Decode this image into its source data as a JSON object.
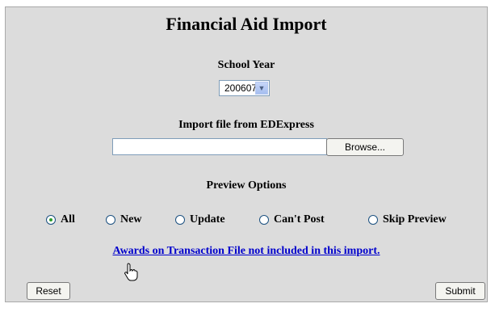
{
  "title": "Financial Aid Import",
  "school_year": {
    "label": "School Year",
    "selected": "200607"
  },
  "import_file": {
    "label": "Import file from EDExpress",
    "value": "",
    "browse_label": "Browse..."
  },
  "preview": {
    "label": "Preview Options",
    "options": [
      "All",
      "New",
      "Update",
      "Can't Post",
      "Skip Preview"
    ],
    "selected": "All"
  },
  "awards_link": "Awards on Transaction File not included in this import.",
  "buttons": {
    "reset": "Reset",
    "submit": "Submit"
  },
  "colors": {
    "panel_bg": "#dcdcdc",
    "link": "#0000cc",
    "radio_dot": "#2e9e2e"
  },
  "icons": {
    "cursor": "hand-pointer-icon",
    "dropdown": "chevron-down-icon"
  }
}
